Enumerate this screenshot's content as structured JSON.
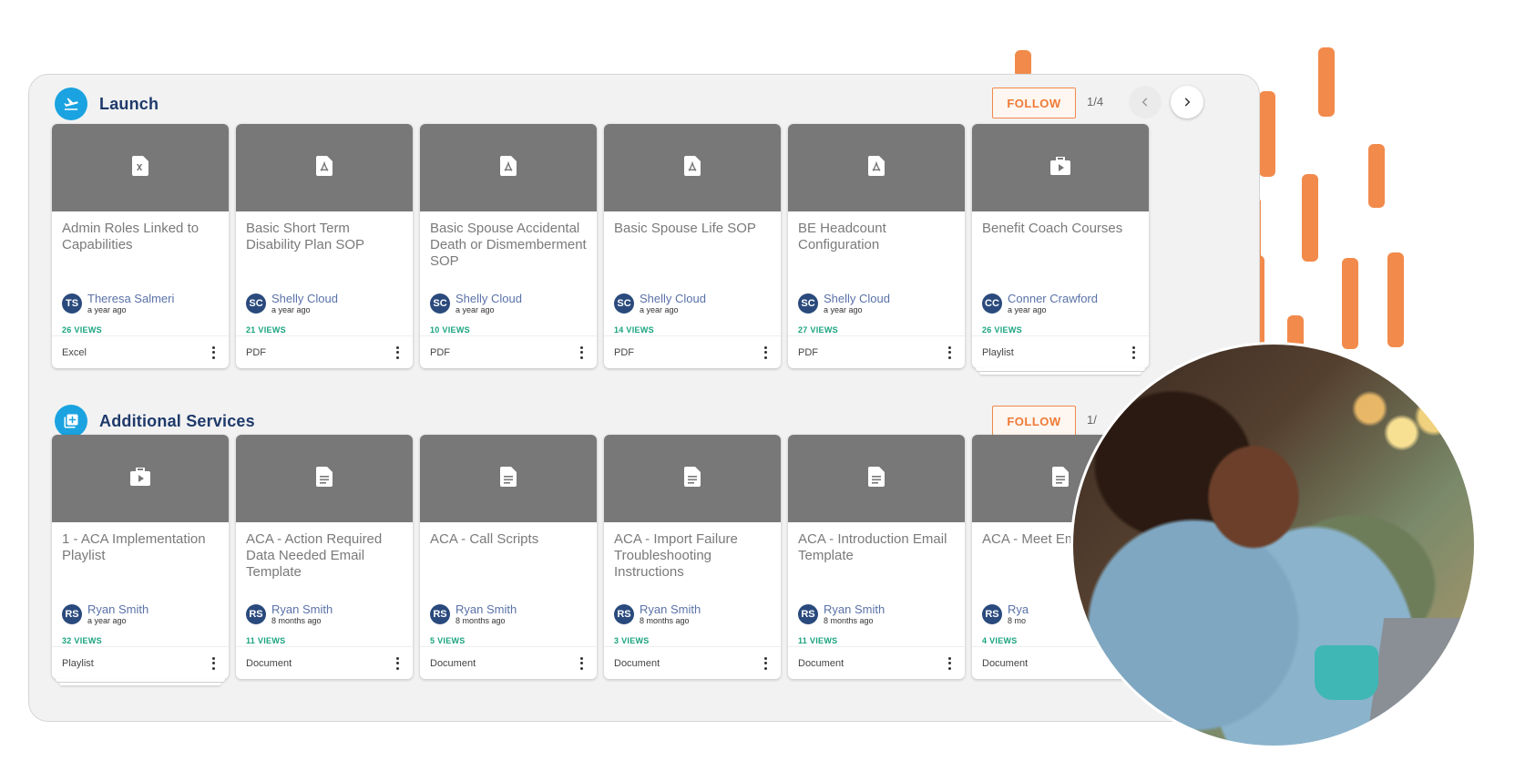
{
  "colors": {
    "accent": "#1aa3e0",
    "brand_orange": "#f07a36",
    "views_green": "#1aa37f",
    "title_navy": "#1f3a6b"
  },
  "sections": [
    {
      "title": "Launch",
      "icon": "airplane-takeoff-icon",
      "follow_label": "FOLLOW",
      "pager": "1/4",
      "cards": [
        {
          "title": "Admin Roles Linked to Capabilities",
          "icon": "excel-file-icon",
          "initials": "TS",
          "author": "Theresa Salmeri",
          "time": "a year ago",
          "views": "26 VIEWS",
          "type": "Excel"
        },
        {
          "title": "Basic Short Term Disability Plan SOP",
          "icon": "pdf-file-icon",
          "initials": "SC",
          "author": "Shelly Cloud",
          "time": "a year ago",
          "views": "21 VIEWS",
          "type": "PDF"
        },
        {
          "title": "Basic Spouse Accidental Death or Dismemberment SOP",
          "icon": "pdf-file-icon",
          "initials": "SC",
          "author": "Shelly Cloud",
          "time": "a year ago",
          "views": "10 VIEWS",
          "type": "PDF"
        },
        {
          "title": "Basic Spouse Life SOP",
          "icon": "pdf-file-icon",
          "initials": "SC",
          "author": "Shelly Cloud",
          "time": "a year ago",
          "views": "14 VIEWS",
          "type": "PDF"
        },
        {
          "title": "BE Headcount Configuration",
          "icon": "pdf-file-icon",
          "initials": "SC",
          "author": "Shelly Cloud",
          "time": "a year ago",
          "views": "27 VIEWS",
          "type": "PDF"
        },
        {
          "title": "Benefit Coach Courses",
          "icon": "playlist-icon",
          "initials": "CC",
          "author": "Conner Crawford",
          "time": "a year ago",
          "views": "26 VIEWS",
          "type": "Playlist"
        }
      ]
    },
    {
      "title": "Additional Services",
      "icon": "add-box-icon",
      "follow_label": "FOLLOW",
      "pager": "1/",
      "cards": [
        {
          "title": "1 - ACA Implementation Playlist",
          "icon": "playlist-icon",
          "initials": "RS",
          "author": "Ryan Smith",
          "time": "a year ago",
          "views": "32 VIEWS",
          "type": "Playlist"
        },
        {
          "title": "ACA - Action Required Data Needed Email Template",
          "icon": "document-icon",
          "initials": "RS",
          "author": "Ryan Smith",
          "time": "8 months ago",
          "views": "11 VIEWS",
          "type": "Document"
        },
        {
          "title": "ACA - Call Scripts",
          "icon": "document-icon",
          "initials": "RS",
          "author": "Ryan Smith",
          "time": "8 months ago",
          "views": "5 VIEWS",
          "type": "Document"
        },
        {
          "title": "ACA - Import Failure Troubleshooting Instructions",
          "icon": "document-icon",
          "initials": "RS",
          "author": "Ryan Smith",
          "time": "8 months ago",
          "views": "3 VIEWS",
          "type": "Document"
        },
        {
          "title": "ACA - Introduction Email Template",
          "icon": "document-icon",
          "initials": "RS",
          "author": "Ryan Smith",
          "time": "8 months ago",
          "views": "11 VIEWS",
          "type": "Document"
        },
        {
          "title": "ACA - Meet Email",
          "icon": "document-icon",
          "initials": "RS",
          "author": "Rya",
          "time": "8 mo",
          "views": "4 VIEWS",
          "type": "Document"
        }
      ]
    }
  ]
}
